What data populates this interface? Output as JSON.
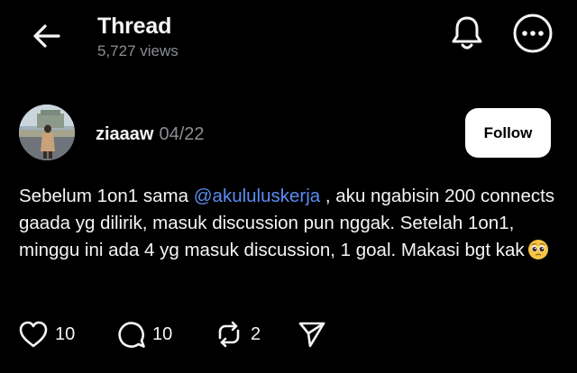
{
  "header": {
    "title": "Thread",
    "views": "5,727 views"
  },
  "post": {
    "username": "ziaaaw",
    "date": "04/22",
    "follow_label": "Follow",
    "text": {
      "part1": "Sebelum 1on1 sama ",
      "mention": "@akululuskerja",
      "part2": " , aku ngabisin 200 connects gaada yg dilirik, masuk discussion pun nggak. Setelah 1on1, minggu ini ada 4 yg masuk discussion, 1 goal. Makasi bgt kak",
      "emoji": "pleading-face-emoji"
    }
  },
  "actions": {
    "likes": "10",
    "replies": "10",
    "reposts": "2"
  },
  "icons": {
    "back": "arrow-left-icon",
    "notifications": "bell-icon",
    "more": "ellipsis-circle-icon",
    "like": "heart-icon",
    "reply": "speech-bubble-icon",
    "repost": "repost-icon",
    "share": "send-icon"
  },
  "colors": {
    "background": "#000000",
    "text": "#f3f5f7",
    "muted": "#8a8d91",
    "mention": "#5b8cf2",
    "follow_bg": "#ffffff",
    "follow_text": "#000000"
  }
}
